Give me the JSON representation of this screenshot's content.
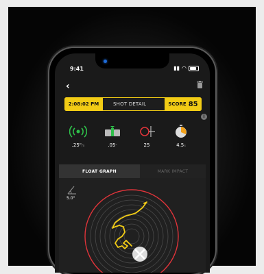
{
  "status": {
    "time": "9:41"
  },
  "header": {
    "shot_time": "2:08:02 PM",
    "title": "SHOT DETAIL",
    "score_label": "SCORE",
    "score_value": "85",
    "info": "i"
  },
  "metrics": [
    {
      "name": "stability",
      "value": ".25\"",
      "unit": "/s"
    },
    {
      "name": "trigger",
      "value": ".05",
      "unit": "\""
    },
    {
      "name": "cant",
      "value": "25",
      "unit": ""
    },
    {
      "name": "timer",
      "value": "4.5",
      "unit": "s"
    }
  ],
  "tabs": {
    "float_graph": "FLOAT GRAPH",
    "mark_impact": "MARK IMPACT"
  },
  "graph": {
    "angle_value": "5.0°"
  },
  "colors": {
    "accent": "#f2cc15",
    "ring": "#e0343a",
    "trace": "#f2cc15"
  },
  "icons": [
    "back-arrow-icon",
    "trash-icon",
    "signal-rings-icon",
    "trigger-icon",
    "crosshair-icon",
    "stopwatch-icon",
    "angle-icon",
    "close-icon"
  ]
}
